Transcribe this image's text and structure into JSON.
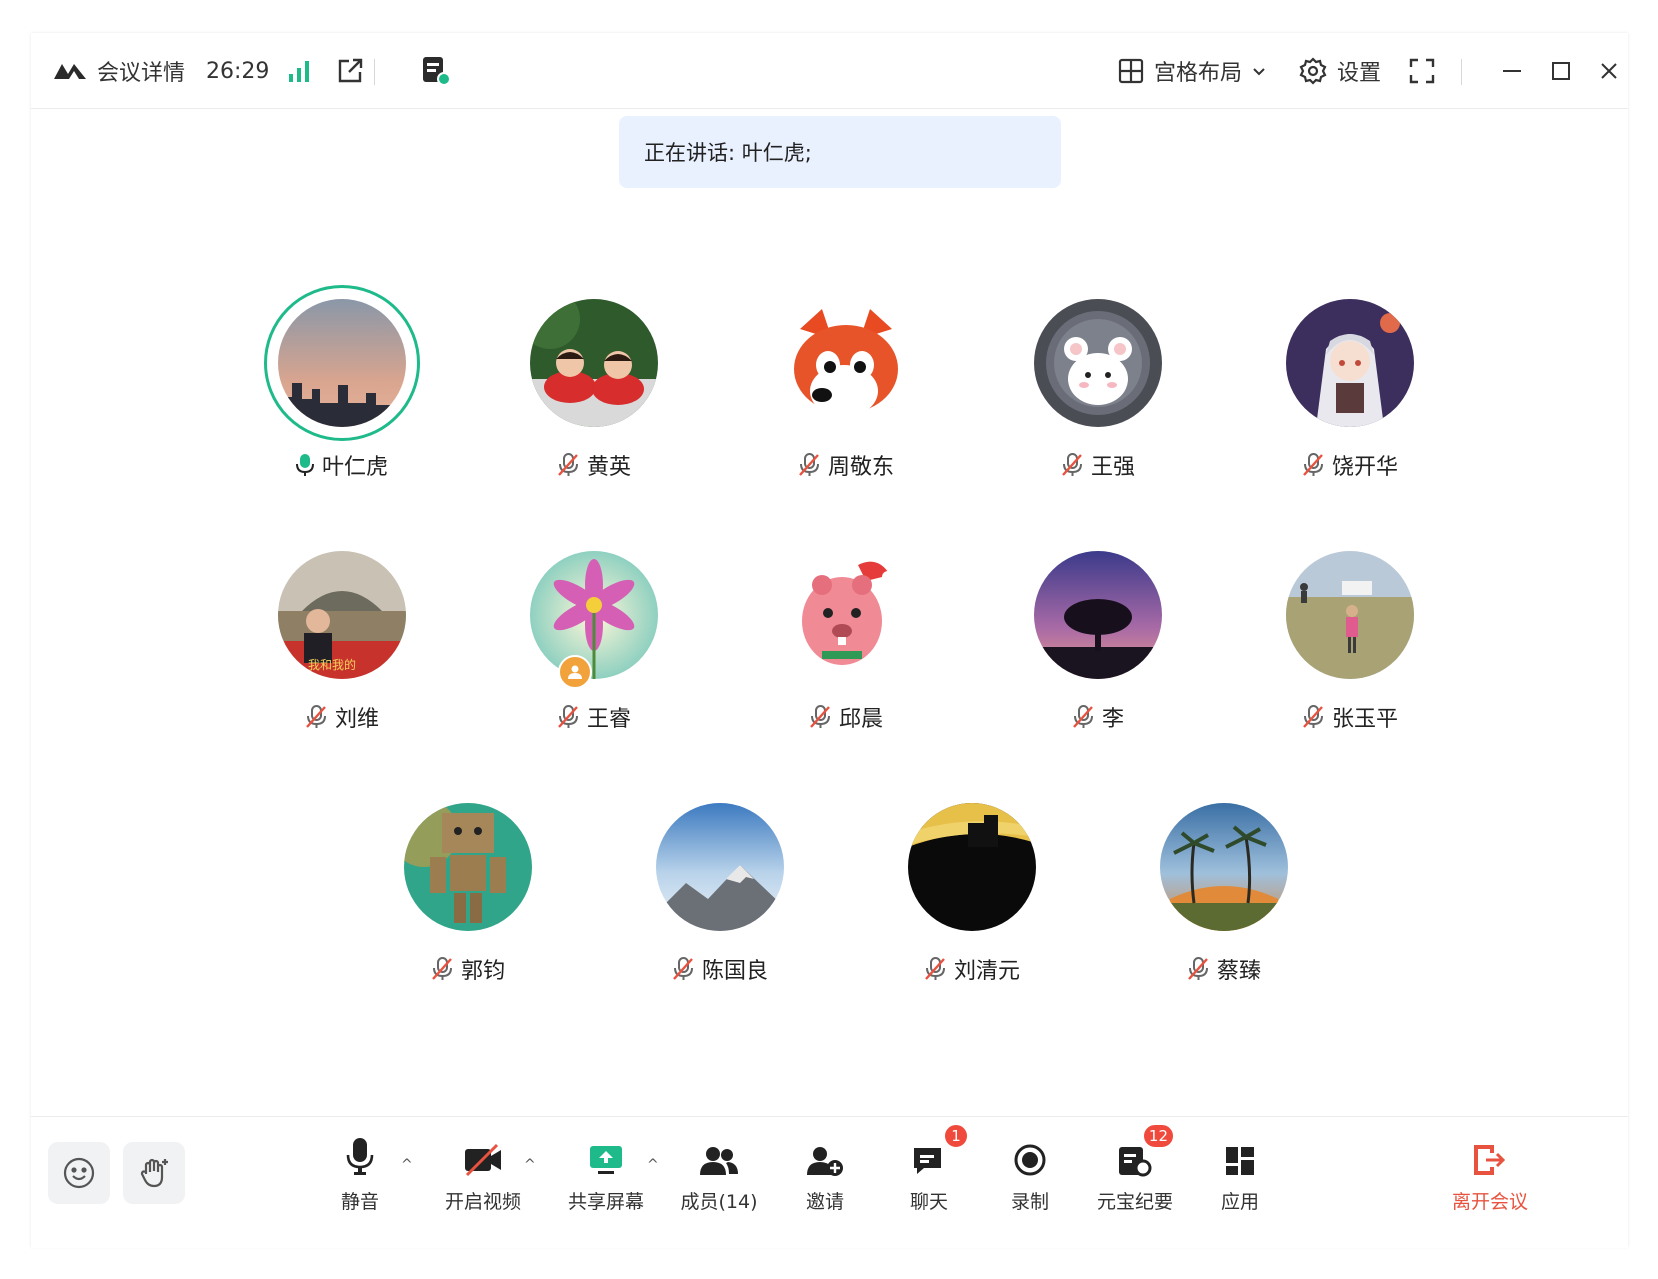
{
  "topbar": {
    "title": "会议详情",
    "timer": "26:29",
    "layout_label": "宫格布局",
    "settings_label": "设置"
  },
  "speaking_banner": "正在讲话: 叶仁虎;",
  "participants": [
    {
      "name": "叶仁虎",
      "mic": "on"
    },
    {
      "name": "黄英",
      "mic": "muted"
    },
    {
      "name": "周敬东",
      "mic": "muted"
    },
    {
      "name": "王强",
      "mic": "muted"
    },
    {
      "name": "饶开华",
      "mic": "muted"
    },
    {
      "name": "刘维",
      "mic": "muted"
    },
    {
      "name": "王睿",
      "mic": "muted"
    },
    {
      "name": "邱晨",
      "mic": "muted"
    },
    {
      "name": "李",
      "mic": "muted"
    },
    {
      "name": "张玉平",
      "mic": "muted"
    },
    {
      "name": "郭钧",
      "mic": "muted"
    },
    {
      "name": "陈国良",
      "mic": "muted"
    },
    {
      "name": "刘清元",
      "mic": "muted"
    },
    {
      "name": "蔡臻",
      "mic": "muted"
    }
  ],
  "toolbar": {
    "mute_label": "静音",
    "video_label": "开启视频",
    "share_label": "共享屏幕",
    "members_label": "成员(14)",
    "invite_label": "邀请",
    "chat_label": "聊天",
    "chat_badge": "1",
    "record_label": "录制",
    "summary_label": "元宝纪要",
    "summary_badge": "12",
    "apps_label": "应用",
    "leave_label": "离开会议"
  },
  "colors": {
    "accent": "#1fba8a",
    "leave": "#e8533f",
    "muted_icon": "#e8533f",
    "banner_bg": "#e9f1fe"
  }
}
